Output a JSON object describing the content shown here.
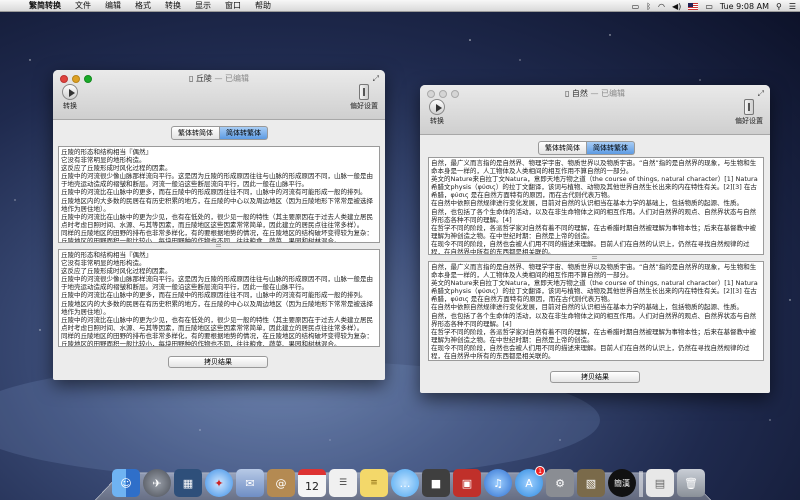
{
  "menubar": {
    "app_name": "繁简转换",
    "items": [
      "文件",
      "编辑",
      "格式",
      "转换",
      "显示",
      "窗口",
      "帮助"
    ],
    "clock": "Tue 9:08 AM"
  },
  "window_left": {
    "title": "丘陵",
    "edited_suffix": "— 已编辑",
    "convert_label": "转换",
    "prefs_label": "偏好设置",
    "seg": [
      "繁体转简体",
      "简体转繁体"
    ],
    "active_seg": 1,
    "top_text": [
      "丘陵的形态和结构相当『偶然』",
      "它没有非常明显的地形构造。",
      "这反应了丘陵形成时风化过程的因素。",
      "丘陵中的河流很少像山脉那样流向平行。这是因为丘陵的形成原因往往与山脉的形成原因不同，山脉一般是由于地壳运动造成的褶皱和断层。河流一般沿这些断层流向平行，因此一般在山脉平行。",
      "丘陵中的河流比在山脉中的更多，而在丘陵中的形成原因往往不同，山脉中的河流有可能形成一般的排列。",
      "丘陵地区内的大多数的民居在有历史积累的地方，在丘陵的中心以及周边地区（因为丘陵地形下常常是被选择地作为居住地）。",
      "丘陵中的河流比在山脉中的更为少见，也有在低处的，很少见一般的特性（其主要原因在于过去人类建立居民点时考虑日照时间、水源、与其等因素，而丘陵地区这些因素常常简单，因此建立的居民点往往常多样）。",
      "同样的丘陵地区的田野的排布也非常多样化，有的要根据地势的情况，在丘陵地区的结构破坏变得较为复杂：丘陵地区的田野面积一般比较小，每块田野种的作物也不同，往往粮食、蔬菜、果园和树林混合。"
    ],
    "bottom_text": [
      "丘陵的形态和结构相当『偶然』",
      "它没有非常明显的地形构造。",
      "这反应了丘陵形成时风化过程的因素。",
      "丘陵中的河流很少像山脉那样流向平行。这是因为丘陵的形成原因往往与山脉的形成原因不同，山脉一般是由于地壳运动造成的褶皱和断层。河流一般沿这些断层流向平行，因此一般在山脉平行。",
      "丘陵中的河流比在山脉中的更多，而在丘陵中的形成原因往往不同，山脉中的河流有可能形成一般的排列。",
      "丘陵地区内的大多数的民居在有历史积累的地方，在丘陵的中心以及周边地区（因为丘陵地形下常常是被选择地作为居住地）。",
      "丘陵中的河流比在山脉中的更为少见，也有在低处的，很少见一般的特性（其主要原因在于过去人类建立居民点时考虑日照时间、水源、与其等因素，而丘陵地区这些因素常常简单，因此建立的居民点往往常多样）。",
      "同样的丘陵地区的田野的排布也非常多样化，有的要根据地势的情况，在丘陵地区的结构破坏变得较为复杂：丘陵地区的田野面积一般比较小，每块田野种的作物也不同，往往粮食、蔬菜、果园和树林混合。"
    ],
    "copy_label": "拷贝结果"
  },
  "window_right": {
    "title": "自然",
    "edited_suffix": "— 已编辑",
    "convert_label": "转换",
    "prefs_label": "偏好设置",
    "seg": [
      "繁体转简体",
      "简体转繁体"
    ],
    "active_seg": 1,
    "top_text": [
      "自然，最广义而言指的是自然界、物理学宇宙、物质世界以及物质宇宙。“自然”指的是自然界的现象，与生物和生命本身是一样的，人工物体及人类相间的相互作用不算自然的一部分。",
      "英文的Nature来自拉丁文Natura，意即天地万物之道（the course of things, natural character）[1] Natura 希腊文physis（φύσις）的拉丁文翻译，该词与植物、动物及其他世界自然生长出来的内在特性有关。[2][3] 在古希腊，φύσις 是在自然方面特有的原因，而在古代则代表万物。",
      "在自然中依照自然规律进行变化发展，目前对自然的认识相当在基本力学的基础上，包括物质的起源、性质。",
      "自然，也包括了各个生命体的活动，以及在非生命物体之间的相互作用。人们对自然界的观点、自然界状态与自然界形态各种不同的理解。[4]",
      "在哲学不同的阶段，各派哲学家对自然有着不同的理解，在古希腊时期自然被理解为事物本性；后来在基督教中被理解为神创造之物。在中世纪时期：自然是上帝的创造。",
      "在现今不同的阶段，自然也会被人们用不同的描述来理解。目前人们在自然的认识上，仍然在寻找自然规律的过程，在自然界中所有的东西都是相关联的。"
    ],
    "bottom_text": [
      "自然，最广义而言指的是自然界、物理学宇宙、物质世界以及物质宇宙。“自然”指的是自然界的现象，与生物和生命本身是一样的，人工物体及人类相间的相互作用不算自然的一部分。",
      "英文的Nature来自拉丁文Natura，意即天地万物之道（the course of things, natural character）[1] Natura 希腊文physis（φύσις）的拉丁文翻译，该词与植物、动物及其他世界自然生长出来的内在特性有关。[2][3] 在古希腊，φύσις 是在自然方面特有的原因，而在古代则代表万物。",
      "在自然中依照自然规律进行变化发展，目前对自然的认识相当在基本力学的基础上，包括物质的起源、性质。",
      "自然，也包括了各个生命体的活动，以及在非生命物体之间的相互作用。人们对自然界的观点、自然界状态与自然界形态各种不同的理解。[4]",
      "在哲学不同的阶段，各派哲学家对自然有着不同的理解，在古希腊时期自然被理解为事物本性；后来在基督教中被理解为神创造之物。在中世纪时期：自然是上帝的创造。",
      "在现今不同的阶段，自然也会被人们用不同的描述来理解。目前人们在自然的认识上，仍然在寻找自然规律的过程，在自然界中所有的东西都是相关联的。"
    ],
    "copy_label": "拷贝结果"
  },
  "dock": {
    "items": [
      {
        "icon": "finder-icon",
        "color": "#3c7fd8"
      },
      {
        "icon": "launchpad-icon",
        "color": "#6b6f78"
      },
      {
        "icon": "mission-control-icon",
        "color": "#2e4f7a"
      },
      {
        "icon": "safari-icon",
        "color": "#3a8ee6"
      },
      {
        "icon": "mail-icon",
        "color": "#6f8ec4"
      },
      {
        "icon": "contacts-icon",
        "color": "#b48a52"
      },
      {
        "icon": "calendar-icon",
        "color": "#f5f5f5"
      },
      {
        "icon": "reminders-icon",
        "color": "#f0f0f0"
      },
      {
        "icon": "notes-icon",
        "color": "#f3d86a"
      },
      {
        "icon": "messages-icon",
        "color": "#4ca6f0"
      },
      {
        "icon": "facetime-icon",
        "color": "#3f3f3f"
      },
      {
        "icon": "photo-booth-icon",
        "color": "#c0302a"
      },
      {
        "icon": "itunes-icon",
        "color": "#2f6fd0"
      },
      {
        "icon": "app-store-icon",
        "color": "#2d8ae0"
      },
      {
        "icon": "system-preferences-icon",
        "color": "#8a8d93"
      },
      {
        "icon": "preview-icon",
        "color": "#7a6a4a"
      },
      {
        "icon": "converter-app-icon",
        "color": "#111111"
      },
      {
        "icon": "document-icon",
        "color": "#e8e8e8"
      },
      {
        "icon": "trash-icon",
        "color": "#9aa0a8"
      }
    ],
    "calendar_day": "12",
    "app_store_badge": "1",
    "converter_glyphs": "簡漢"
  }
}
